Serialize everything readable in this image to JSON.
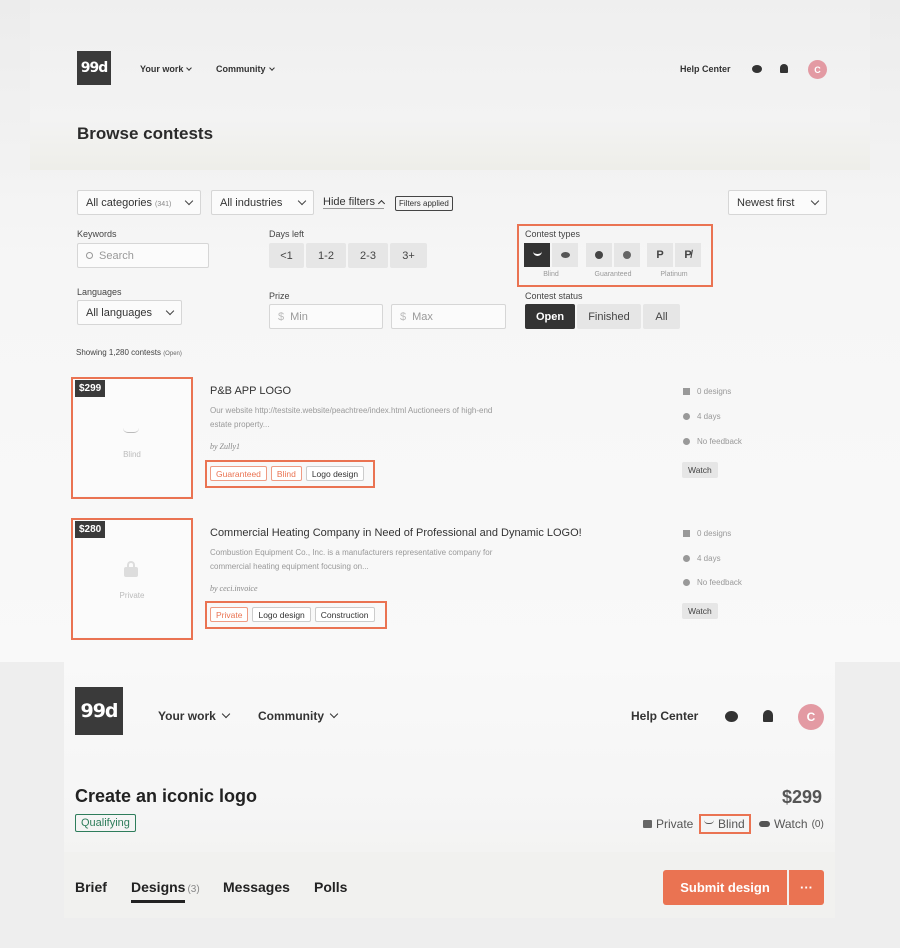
{
  "browse": {
    "header": {
      "logo": "99d",
      "nav": [
        {
          "label": "Your work"
        },
        {
          "label": "Community"
        }
      ],
      "help_center": "Help Center",
      "avatar_initial": "C"
    },
    "page_title": "Browse contests",
    "filters": {
      "categories": {
        "label": "All categories",
        "count": "(341)"
      },
      "industries": {
        "label": "All industries"
      },
      "hide_filters": "Hide filters",
      "filters_applied": "Filters applied",
      "sort": {
        "label": "Newest first"
      },
      "keywords": {
        "label": "Keywords",
        "placeholder": "Search"
      },
      "days_left": {
        "label": "Days left",
        "options": [
          "<1",
          "1-2",
          "2-3",
          "3+"
        ]
      },
      "languages": {
        "label": "Languages",
        "value": "All languages"
      },
      "prize": {
        "label": "Prize",
        "currency": "$",
        "min_placeholder": "Min",
        "max_placeholder": "Max"
      },
      "contest_types": {
        "label": "Contest types",
        "groups": [
          {
            "caption": "Blind",
            "buttons": [
              {
                "icon": "blind-icon",
                "active": true
              },
              {
                "icon": "eye-icon",
                "active": false
              }
            ]
          },
          {
            "caption": "Guaranteed",
            "buttons": [
              {
                "icon": "guaranteed-icon",
                "active": false
              },
              {
                "icon": "not-guaranteed-icon",
                "active": false
              }
            ]
          },
          {
            "caption": "Platinum",
            "buttons": [
              {
                "icon": "platinum-icon",
                "glyph": "P",
                "active": false
              },
              {
                "icon": "not-platinum-icon",
                "glyph": "P̸",
                "active": false
              }
            ]
          }
        ]
      },
      "contest_status": {
        "label": "Contest status",
        "options": [
          "Open",
          "Finished",
          "All"
        ],
        "selected": "Open"
      }
    },
    "results": {
      "showing": "Showing 1,280 contests",
      "status": "(Open)"
    },
    "contests": [
      {
        "price": "$299",
        "thumb_caption": "Blind",
        "thumb_icon": "blind-icon",
        "title": "P&B APP LOGO",
        "desc_line1": "Our website http://testsite.website/peachtree/index.html Auctioneers of high-end",
        "desc_line2": "estate property...",
        "by": "by Zully1",
        "tags": [
          {
            "label": "Guaranteed",
            "accent": true
          },
          {
            "label": "Blind",
            "accent": true
          },
          {
            "label": "Logo design",
            "accent": false
          }
        ],
        "designs": "0 designs",
        "days": "4 days",
        "feedback": "No feedback",
        "watch": "Watch"
      },
      {
        "price": "$280",
        "thumb_caption": "Private",
        "thumb_icon": "lock-icon",
        "title": "Commercial Heating Company in Need of Professional and Dynamic LOGO!",
        "desc_line1": "Combustion Equipment Co., Inc. is a manufacturers representative company for",
        "desc_line2": "commercial heating equipment focusing on...",
        "by": "by ceci.invoice",
        "tags": [
          {
            "label": "Private",
            "accent": true
          },
          {
            "label": "Logo design",
            "accent": false
          },
          {
            "label": "Construction",
            "accent": false
          }
        ],
        "designs": "0 designs",
        "days": "4 days",
        "feedback": "No feedback",
        "watch": "Watch"
      }
    ]
  },
  "detail": {
    "header": {
      "logo": "99d",
      "nav": [
        {
          "label": "Your work"
        },
        {
          "label": "Community"
        }
      ],
      "help_center": "Help Center",
      "avatar_initial": "C"
    },
    "title": "Create an iconic logo",
    "status_badge": "Qualifying",
    "price": "$299",
    "meta": {
      "private": "Private",
      "blind": "Blind",
      "watch": "Watch",
      "watch_count": "(0)"
    },
    "tabs": [
      {
        "label": "Brief",
        "count": ""
      },
      {
        "label": "Designs",
        "count": "(3)",
        "active": true
      },
      {
        "label": "Messages",
        "count": ""
      },
      {
        "label": "Polls",
        "count": ""
      }
    ],
    "submit_label": "Submit design",
    "more_label": "···"
  },
  "colors": {
    "accent": "#ea7352",
    "dark": "#333333",
    "qualifying": "#2e7d5b",
    "avatar": "#e39aa3"
  }
}
